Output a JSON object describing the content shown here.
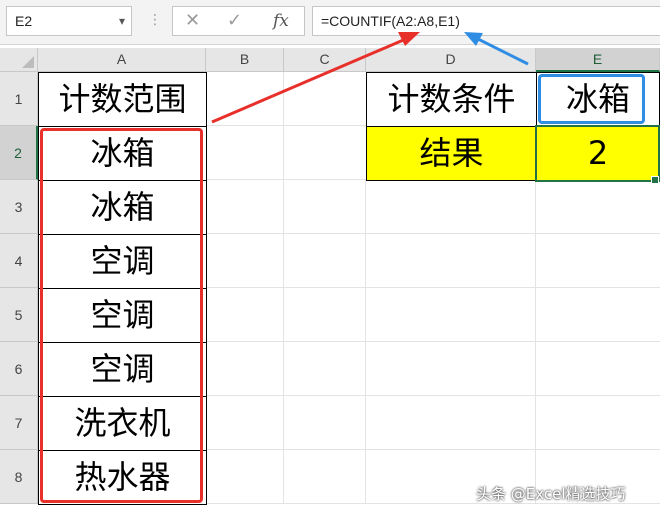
{
  "formula_bar": {
    "name_box": "E2",
    "name_dropdown_icon": "chevron-down-icon",
    "cancel_icon": "close-icon",
    "enter_icon": "check-icon",
    "fx_label": "fx",
    "formula": "=COUNTIF(A2:A8,E1)"
  },
  "columns": [
    "A",
    "B",
    "C",
    "D",
    "E"
  ],
  "rows": [
    "1",
    "2",
    "3",
    "4",
    "5",
    "6",
    "7",
    "8"
  ],
  "cells": {
    "A1": "计数范围",
    "A2": "冰箱",
    "A3": "冰箱",
    "A4": "空调",
    "A5": "空调",
    "A6": "空调",
    "A7": "洗衣机",
    "A8": "热水器",
    "D1": "计数条件",
    "E1": "冰箱",
    "D2": "结果",
    "E2": "2"
  },
  "colors": {
    "highlight_fill": "#ffff00",
    "range_annotation": "#e8302b",
    "criteria_annotation": "#2f8de4",
    "selection": "#217346"
  },
  "watermark": "头条 @Excel精选技巧"
}
